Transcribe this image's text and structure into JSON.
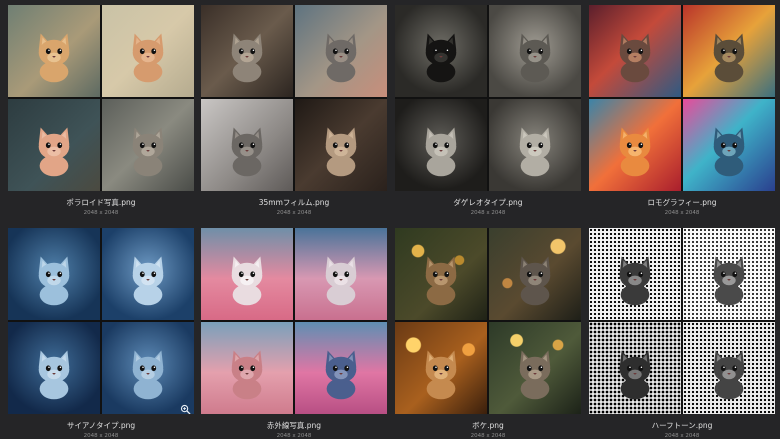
{
  "files": [
    {
      "name": "ポラロイド写真.png",
      "dims": "2048 x 2048",
      "tiles": [
        {
          "bg": "linear-gradient(135deg,#6f7f73,#a99a78 55%,#5d6a62)",
          "cat": "#d9a56c",
          "accent": "#f2d6a8"
        },
        {
          "bg": "linear-gradient(135deg,#c9c2a6,#d7c9a9 50%,#b5ab8f)",
          "cat": "#d69b6e",
          "accent": "#f0c7a3"
        },
        {
          "bg": "linear-gradient(135deg,#2d3c40,#3f5357 60%,#4b4a40)",
          "cat": "#e2a587",
          "accent": "#f3cfb9"
        },
        {
          "bg": "linear-gradient(135deg,#5c5f5a,#8a8a80 50%,#4a4c48)",
          "cat": "#8a8378",
          "accent": "#c9c0b0"
        }
      ]
    },
    {
      "name": "35mmフィルム.png",
      "dims": "2048 x 2048",
      "tiles": [
        {
          "bg": "linear-gradient(135deg,#3a2f28,#6a5b4c 50%,#2c2520)",
          "cat": "#8e8478",
          "accent": "#cbbba6"
        },
        {
          "bg": "linear-gradient(135deg,#5e7380,#a39686 55%,#c88e7b)",
          "cat": "#6f6a66",
          "accent": "#b7a999"
        },
        {
          "bg": "linear-gradient(135deg,#c9c6c4,#8d8986 60%,#5e5a58)",
          "cat": "#6b6763",
          "accent": "#b3aca4"
        },
        {
          "bg": "linear-gradient(135deg,#1f1915,#4a3b30 50%,#2a211c)",
          "cat": "#b49a80",
          "accent": "#e0c7a8"
        }
      ]
    },
    {
      "name": "ダゲレオタイプ.png",
      "dims": "2048 x 2048",
      "tiles": [
        {
          "bg": "radial-gradient(circle at 50% 45%,#6f6d66,#2b2a27 70%)",
          "cat": "#151413",
          "accent": "#4a4844"
        },
        {
          "bg": "radial-gradient(circle at 50% 45%,#9f9b92,#4b4944 75%)",
          "cat": "#5d5a54",
          "accent": "#bdb8ad"
        },
        {
          "bg": "radial-gradient(circle at 50% 45%,#5e5c57,#1e1d1b 72%)",
          "cat": "#a9a59c",
          "accent": "#d8d4ca"
        },
        {
          "bg": "radial-gradient(circle at 50% 45%,#87847c,#3a3834 75%)",
          "cat": "#b2aea4",
          "accent": "#dedad0"
        }
      ]
    },
    {
      "name": "ロモグラフィー.png",
      "dims": "2048 x 2048",
      "tiles": [
        {
          "bg": "linear-gradient(135deg,#5b1f2c,#c44a3a 45%,#2f5a83)",
          "cat": "#6a4a3e",
          "accent": "#e8a47c"
        },
        {
          "bg": "linear-gradient(135deg,#b9342a,#e7a23a 50%,#3a6f7f)",
          "cat": "#5b4d39",
          "accent": "#d9b47a"
        },
        {
          "bg": "linear-gradient(135deg,#3b84a8,#f1703a 50%,#a91e2d)",
          "cat": "#e98a3f",
          "accent": "#ffd08c"
        },
        {
          "bg": "linear-gradient(135deg,#e94b9a,#3fb3c9 45%,#2a3f8e)",
          "cat": "#2f5c7a",
          "accent": "#9ad6e5"
        }
      ]
    },
    {
      "name": "サイアノタイプ.png",
      "dims": "2048 x 2048",
      "tiles": [
        {
          "bg": "radial-gradient(circle at 50% 45%,#4f7fa9,#163457 75%)",
          "cat": "#9cc0dc",
          "accent": "#d8e8f4"
        },
        {
          "bg": "radial-gradient(circle at 50% 45%,#6c98c2,#1c4069 75%)",
          "cat": "#b7d2e8",
          "accent": "#e4eff8"
        },
        {
          "bg": "radial-gradient(circle at 50% 45%,#3f6c97,#12294a 75%)",
          "cat": "#a7c6df",
          "accent": "#dbe9f5"
        },
        {
          "bg": "radial-gradient(circle at 50% 45%,#5c89b5,#1a3a61 75%)",
          "cat": "#8fb3d2",
          "accent": "#cfe0ef"
        }
      ]
    },
    {
      "name": "赤外線写真.png",
      "dims": "2048 x 2048",
      "tiles": [
        {
          "bg": "linear-gradient(180deg,#6f8fa8,#e48aa0 55%,#d86a86)",
          "cat": "#e9dce0",
          "accent": "#ffffff"
        },
        {
          "bg": "linear-gradient(180deg,#4a7399,#d898b2 55%,#c9708f)",
          "cat": "#d9cdd4",
          "accent": "#f6eef2"
        },
        {
          "bg": "linear-gradient(180deg,#7aa0bb,#e4a0ad 55%,#cf7b8d)",
          "cat": "#c98087",
          "accent": "#ecc2c6"
        },
        {
          "bg": "linear-gradient(180deg,#5f8fb3,#e076a4 55%,#b84f84)",
          "cat": "#4a5f8e",
          "accent": "#a9b6d6"
        }
      ]
    },
    {
      "name": "ボケ.png",
      "dims": "2048 x 2048",
      "tiles": [
        {
          "bg": "radial-gradient(circle at 25% 25%,#e2b24a 0 6%,transparent 7%),radial-gradient(circle at 70% 35%,#b98a2e 0 5%,transparent 6%),linear-gradient(135deg,#2f3a20,#4c4a2a 60%,#1f2216)",
          "cat": "#8c6a44",
          "accent": "#d6b48a"
        },
        {
          "bg": "radial-gradient(circle at 75% 20%,#f2c56a 0 7%,transparent 8%),radial-gradient(circle at 20% 60%,#c08642 0 5%,transparent 6%),linear-gradient(135deg,#3a3f2e,#5a4a30 55%,#1e1f18)",
          "cat": "#5e554c",
          "accent": "#b0a596"
        },
        {
          "bg": "radial-gradient(circle at 20% 25%,#ffd36a 0 7%,transparent 8%),radial-gradient(circle at 80% 30%,#f0a040 0 6%,transparent 7%),linear-gradient(135deg,#6a3a14,#a9601e 55%,#3a1f0c)",
          "cat": "#c58a4f",
          "accent": "#f2cc96"
        },
        {
          "bg": "radial-gradient(circle at 30% 20%,#f5d06a 0 6%,transparent 7%),radial-gradient(circle at 75% 25%,#d9a446 0 5%,transparent 6%),linear-gradient(135deg,#2d3a28,#4f5a3a 55%,#1c2218)",
          "cat": "#7a6c5c",
          "accent": "#c9b9a2"
        }
      ]
    },
    {
      "name": "ハーフトーン.png",
      "dims": "2048 x 2048",
      "tiles": [
        {
          "bg": "radial-gradient(circle,#000 1px,transparent 1.3px) 0 0/4px 4px,#f2f2f2",
          "cat": "#3a3a3a",
          "accent": "#bdbdbd"
        },
        {
          "bg": "radial-gradient(circle,#000 0.8px,transparent 1.1px) 0 0/4px 4px,#fafafa",
          "cat": "#4a4a4a",
          "accent": "#cfcfcf"
        },
        {
          "bg": "radial-gradient(circle,#000 1.2px,transparent 1.5px) 0 0/4px 4px,#e6e6e6",
          "cat": "#2e2e2e",
          "accent": "#a9a9a9"
        },
        {
          "bg": "radial-gradient(circle,#000 1px,transparent 1.3px) 0 0/4px 4px,#ededed",
          "cat": "#444444",
          "accent": "#c4c4c4"
        }
      ]
    }
  ],
  "icons": {
    "zoom": "magnifier-zoom-icon"
  }
}
